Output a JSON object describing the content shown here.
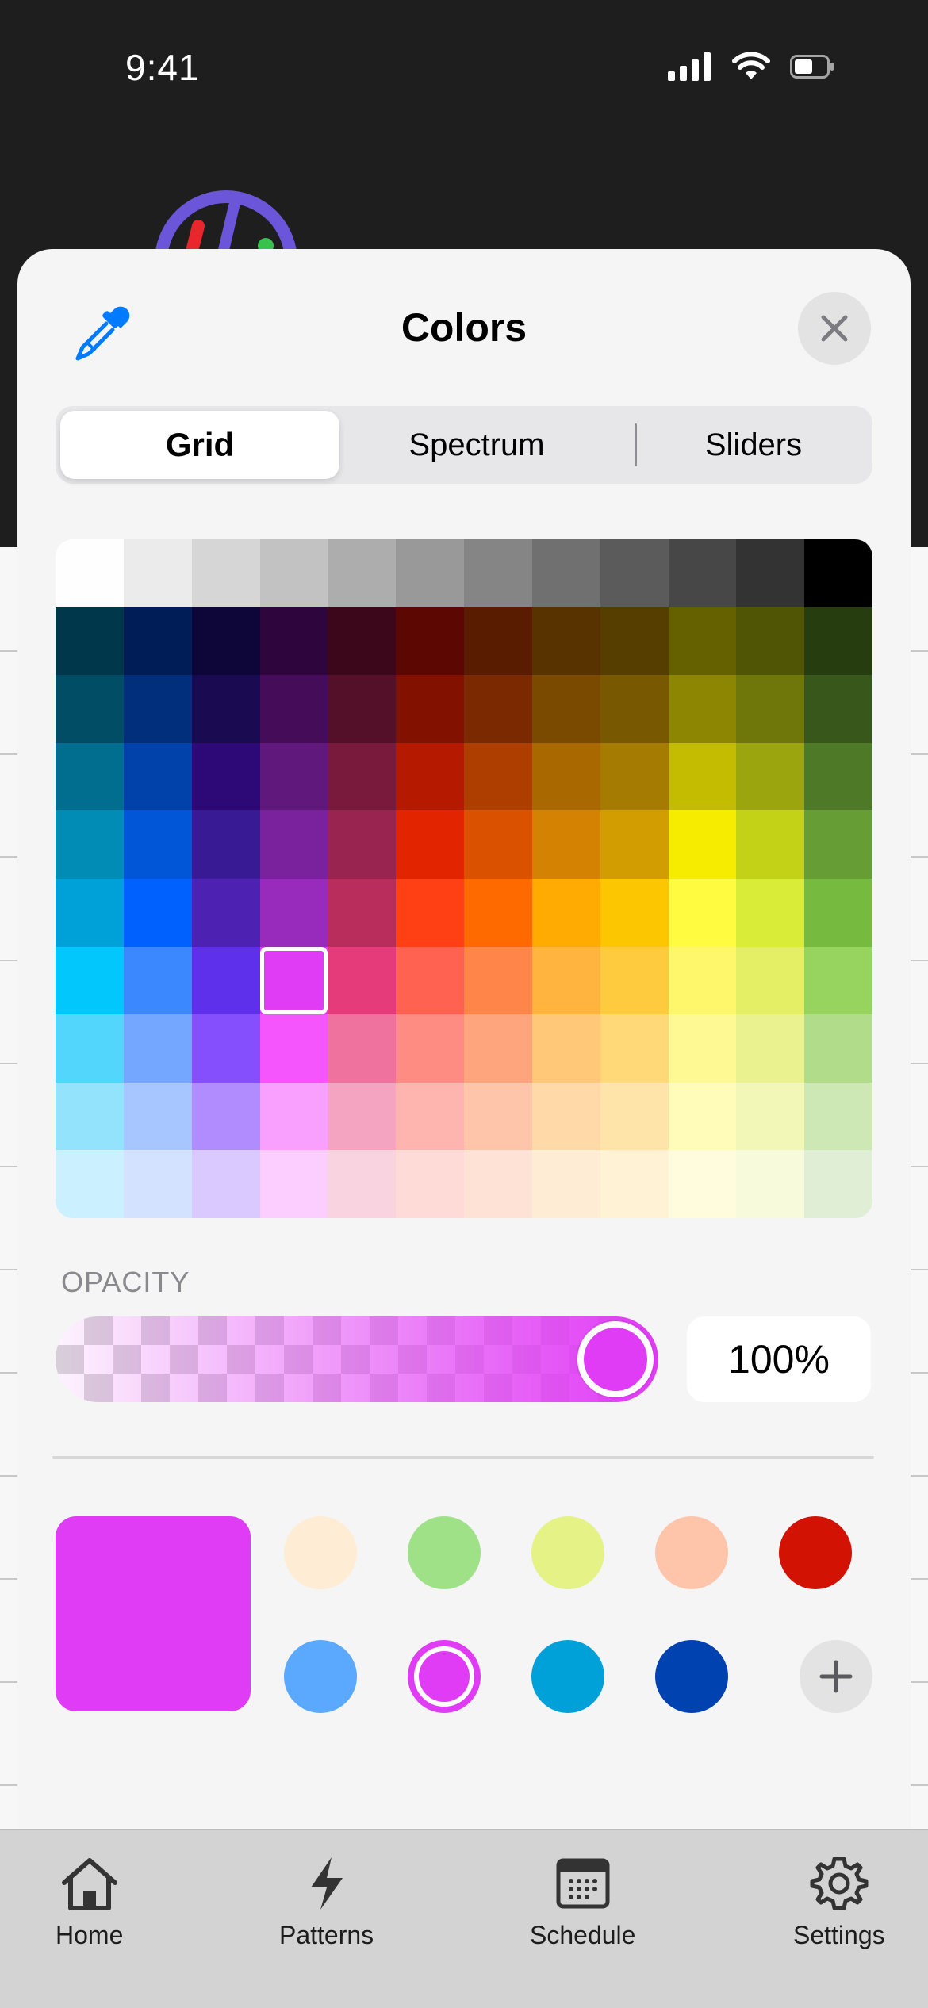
{
  "status_bar": {
    "time": "9:41",
    "icons": [
      "cellular-signal-icon",
      "wifi-icon",
      "battery-icon"
    ]
  },
  "sheet": {
    "title": "Colors",
    "left_icon": "eyedropper-icon",
    "close_icon": "close-icon",
    "tabs": [
      {
        "label": "Grid",
        "active": true
      },
      {
        "label": "Spectrum",
        "active": false
      },
      {
        "label": "Sliders",
        "active": false
      }
    ],
    "grid": {
      "selected_row": 6,
      "selected_col": 3,
      "rows": [
        [
          "#fefefe",
          "#ebebeb",
          "#d6d6d6",
          "#c2c2c2",
          "#adadad",
          "#999999",
          "#858585",
          "#707070",
          "#5b5b5b",
          "#474747",
          "#333333",
          "#000000"
        ],
        [
          "#00374a",
          "#011d57",
          "#0e0538",
          "#2e063d",
          "#3c071b",
          "#5c0701",
          "#5a1c00",
          "#583300",
          "#563d00",
          "#666100",
          "#4f5504",
          "#263e0f"
        ],
        [
          "#004d65",
          "#012f7b",
          "#1a0a52",
          "#450d59",
          "#551029",
          "#831100",
          "#7b2900",
          "#7a4a00",
          "#785800",
          "#8c8602",
          "#6f760a",
          "#38571a"
        ],
        [
          "#016e8f",
          "#0042a9",
          "#2c0977",
          "#61187c",
          "#791a3d",
          "#b51a00",
          "#ad3e00",
          "#a96800",
          "#a67b01",
          "#c4bc00",
          "#9ba50e",
          "#4e7a27"
        ],
        [
          "#008cb4",
          "#0056d6",
          "#371a94",
          "#7a219e",
          "#99244f",
          "#e22400",
          "#da5100",
          "#d38301",
          "#d19d01",
          "#f5ec00",
          "#c3d117",
          "#669d34"
        ],
        [
          "#00a1d8",
          "#0061fe",
          "#4d22b2",
          "#982abc",
          "#b92d5d",
          "#ff4015",
          "#ff6a00",
          "#ffab01",
          "#fcc700",
          "#fefb41",
          "#d9ec37",
          "#76bb40"
        ],
        [
          "#01c7fc",
          "#3a87fe",
          "#5e30eb",
          "#e03cf5",
          "#e63b7a",
          "#ff6251",
          "#ff8648",
          "#feb43f",
          "#fecb3e",
          "#fff76b",
          "#e4ef65",
          "#96d35f"
        ],
        [
          "#52d6fc",
          "#74a7ff",
          "#864ffe",
          "#f455fd",
          "#ee719e",
          "#ff8c82",
          "#ffa57d",
          "#ffc777",
          "#ffd977",
          "#fff994",
          "#eaf28f",
          "#b1dd8b"
        ],
        [
          "#93e3fc",
          "#a7c6ff",
          "#b18cfe",
          "#f9a0fe",
          "#f4a4c0",
          "#ffb5af",
          "#ffc5ab",
          "#ffd9a8",
          "#fee4a8",
          "#fffbb9",
          "#f2f7b7",
          "#cde8b5"
        ],
        [
          "#cbf0ff",
          "#d3e2ff",
          "#d9c9fe",
          "#fccdff",
          "#f9d3e0",
          "#ffdbd8",
          "#ffe2d6",
          "#ffecd4",
          "#fff2d5",
          "#fefcdd",
          "#f7fadb",
          "#dfeed4"
        ]
      ]
    },
    "opacity": {
      "label": "OPACITY",
      "value": 1.0,
      "value_text": "100%",
      "color": "#e03cf5"
    },
    "current_color": "#e03cf5",
    "saved_colors": {
      "row1": [
        "#ffecd4",
        "#9ee187",
        "#e5f286",
        "#ffc5ab",
        "#d21304"
      ],
      "row2": [
        "#5aa9ff",
        "#e03cf5",
        "#00a1d8",
        "#0042b0"
      ],
      "selected_index_row2": 1,
      "add_icon": "plus-icon"
    }
  },
  "tab_bar": {
    "items": [
      {
        "label": "Home",
        "icon": "home-icon"
      },
      {
        "label": "Patterns",
        "icon": "lightning-bolt-icon"
      },
      {
        "label": "Schedule",
        "icon": "calendar-icon"
      },
      {
        "label": "Settings",
        "icon": "gear-icon"
      }
    ]
  }
}
